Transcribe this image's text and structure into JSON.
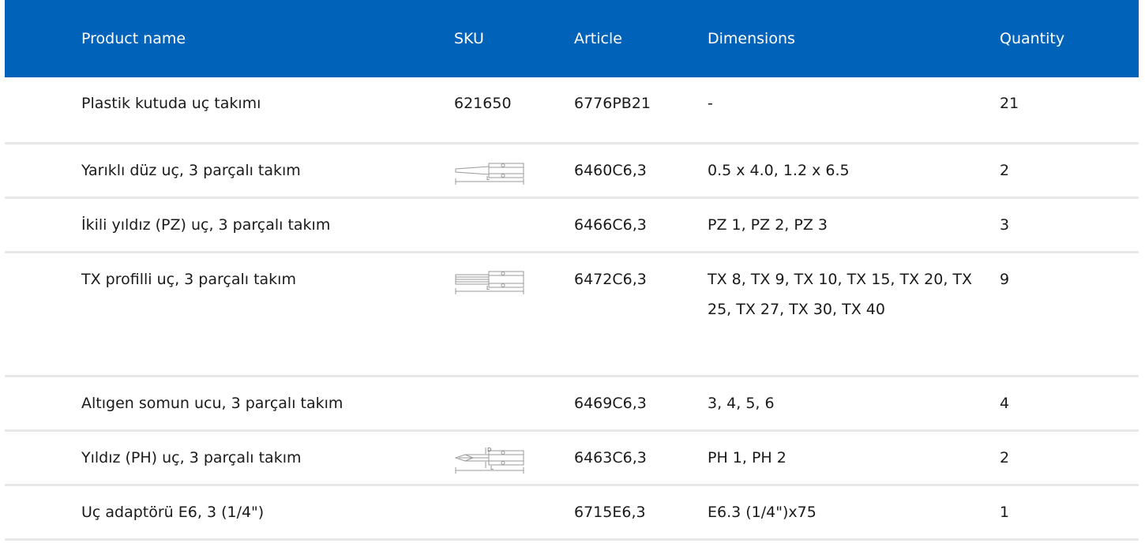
{
  "table": {
    "columns": [
      "Product name",
      "SKU",
      "Article",
      "Dimensions",
      "Quantity"
    ],
    "rows": [
      {
        "name": "Plastik kutuda uç takımı",
        "sku": "621650",
        "article": "6776PB21",
        "dimensions": "-",
        "quantity": "21"
      },
      {
        "name": "Yarıklı düz uç, 3 parçalı takım",
        "sku_drawing": "slotted-bit-drawing-icon",
        "sku_drawing_label": "L",
        "article": "6460C6,3",
        "dimensions": "0.5 x 4.0, 1.2 x 6.5",
        "quantity": "2"
      },
      {
        "name": "İkili yıldız (PZ) uç, 3 parçalı takım",
        "sku": "",
        "article": "6466C6,3",
        "dimensions": "PZ 1, PZ 2, PZ 3",
        "quantity": "3"
      },
      {
        "name": "TX profilli uç, 3 parçalı takım",
        "sku_drawing": "torx-bit-drawing-icon",
        "sku_drawing_label": "L",
        "article": "6472C6,3",
        "dimensions": "TX 8, TX 9, TX 10, TX 15, TX 20, TX 25, TX 27, TX 30, TX 40",
        "quantity": "9"
      },
      {
        "name": "Altıgen somun ucu, 3 parçalı takım",
        "sku": "",
        "article": "6469C6,3",
        "dimensions": "3, 4, 5, 6",
        "quantity": "4"
      },
      {
        "name": "Yıldız (PH) uç, 3 parçalı takım",
        "sku_drawing": "phillips-bit-drawing-icon",
        "sku_drawing_label": "L",
        "sku_drawing_label2": "D",
        "article": "6463C6,3",
        "dimensions": "PH 1, PH 2",
        "quantity": "2"
      },
      {
        "name": "Uç adaptörü E6, 3 (1/4\")",
        "sku": "",
        "article": "6715E6,3",
        "dimensions": "E6.3 (1/4\")x75",
        "quantity": "1"
      }
    ]
  },
  "colors": {
    "header_bg": "#0062b9",
    "header_text": "#ffffff",
    "row_divider": "#e8e8e8"
  }
}
